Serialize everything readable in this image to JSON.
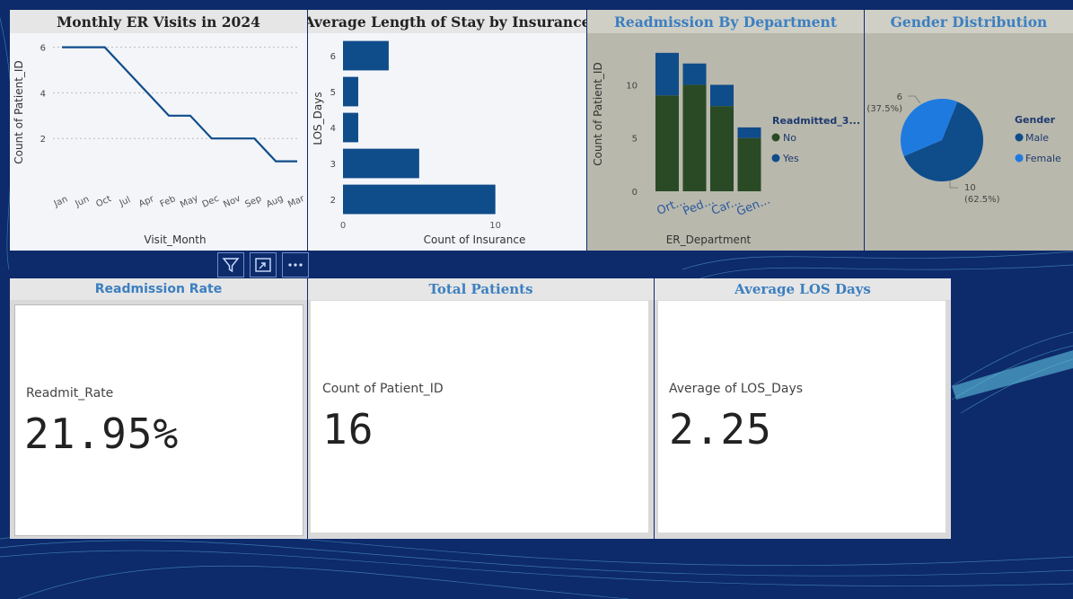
{
  "colors": {
    "background": "#0d2a6b",
    "navy": "#0f4c8a",
    "dark_green": "#2a4a25",
    "light_blue": "#1f7ae0",
    "title_blue": "#3c7fc0"
  },
  "line_chart": {
    "title": "Monthly ER Visits in 2024",
    "chart_data": {
      "type": "line",
      "title": "Monthly ER Visits in 2024",
      "xlabel": "Visit_Month",
      "ylabel": "Count of Patient_ID",
      "categories": [
        "Jan",
        "Jun",
        "Oct",
        "Jul",
        "Apr",
        "Feb",
        "May",
        "Dec",
        "Nov",
        "Sep",
        "Aug",
        "Mar"
      ],
      "values": [
        6,
        6,
        6,
        5,
        4,
        3,
        3,
        2,
        2,
        2,
        1,
        1
      ],
      "yticks": [
        2,
        4,
        6
      ],
      "ylim": [
        0,
        6.3
      ],
      "grid": true
    }
  },
  "bar_chart": {
    "title": "Average Length of Stay by Insurance",
    "chart_data": {
      "type": "bar",
      "orientation": "horizontal",
      "title": "Average Length of Stay by Insurance",
      "xlabel": "Count of Insurance",
      "ylabel": "LOS_Days",
      "categories": [
        "6",
        "5",
        "4",
        "3",
        "2"
      ],
      "values": [
        3,
        1,
        1,
        5,
        10
      ],
      "xticks": [
        0,
        10
      ],
      "xlim": [
        0,
        15.5
      ]
    }
  },
  "stacked_chart": {
    "title": "Readmission By Department",
    "legend_title": "Readmitted_3...",
    "chart_data": {
      "type": "bar",
      "stacked": true,
      "title": "Readmission By Department",
      "xlabel": "ER_Department",
      "ylabel": "Count of Patient_ID",
      "categories": [
        "Ort...",
        "Ped...",
        "Car...",
        "Gen..."
      ],
      "series": [
        {
          "name": "No",
          "values": [
            9,
            10,
            8,
            5
          ],
          "color": "#2a4a25"
        },
        {
          "name": "Yes",
          "values": [
            4,
            2,
            2,
            1
          ],
          "color": "#0f4c8a"
        }
      ],
      "yticks": [
        0,
        5,
        10
      ],
      "ylim": [
        0,
        14
      ],
      "legend": "right"
    }
  },
  "pie_chart": {
    "title": "Gender Distribution",
    "legend_title": "Gender",
    "label_male_count": "10",
    "label_male_pct": "(62.5%)",
    "label_female_count": "6",
    "label_female_pct": "(37.5%)",
    "chart_data": {
      "type": "pie",
      "title": "Gender Distribution",
      "slices": [
        {
          "label": "Male",
          "value": 10,
          "percent": 62.5,
          "color": "#0f4c8a"
        },
        {
          "label": "Female",
          "value": 6,
          "percent": 37.5,
          "color": "#1f7ae0"
        }
      ],
      "legend": "right"
    }
  },
  "kpis": {
    "readmission": {
      "title": "Readmission Rate",
      "label": "Readmit_Rate",
      "value": "21.95%"
    },
    "patients": {
      "title": "Total Patients",
      "label": "Count of Patient_ID",
      "value": "16"
    },
    "los": {
      "title": "Average LOS Days",
      "label": "Average of LOS_Days",
      "value": "2.25"
    }
  },
  "toolbar": {
    "filter_icon": "filter-icon",
    "focus_icon": "focus-mode-icon",
    "more_icon": "more-options-icon"
  }
}
